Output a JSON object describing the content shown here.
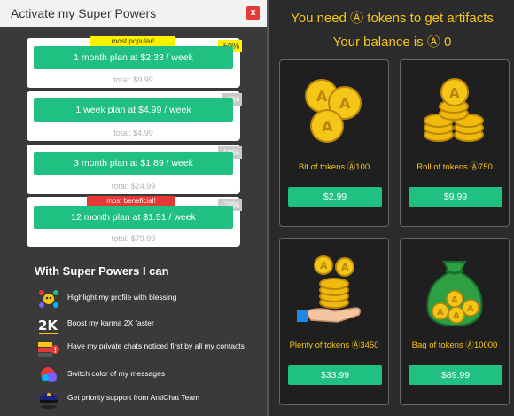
{
  "header": {
    "title": "Activate my Super Powers",
    "close": "x"
  },
  "plans": [
    {
      "button": "1 month plan at $2.33 / week",
      "total": "total: $9.99",
      "discount": "-50%",
      "ribbon": "most popular!"
    },
    {
      "button": "1 week plan at $4.99 / week",
      "total": "total: $4.99",
      "discount": "-0%",
      "ribbon": ""
    },
    {
      "button": "3 month plan at $1.89 / week",
      "total": "total: $24.99",
      "discount": "-60%",
      "ribbon": ""
    },
    {
      "button": "12 month plan at $1.51 / week",
      "total": "total: $79.99",
      "discount": "-70%",
      "ribbon": "most beneficial!"
    }
  ],
  "superpowers": {
    "title": "With Super Powers I can",
    "items": [
      {
        "icon": "blessing-icon",
        "text": "Highlight my profile with blessing"
      },
      {
        "icon": "karma-2x-icon",
        "text": "Boost my karma 2X faster"
      },
      {
        "icon": "chat-notice-icon",
        "text": "Have my private chats noticed first by all my contacts"
      },
      {
        "icon": "color-bubble-icon",
        "text": "Switch color of my messages"
      },
      {
        "icon": "support-icon",
        "text": "Get priority support from AntiChat Team"
      }
    ]
  },
  "shop": {
    "line1": "You need Ⓐ tokens to get artifacts",
    "line2": "Your balance is Ⓐ 0",
    "packs": [
      {
        "icon": "coins-pile-icon",
        "name": "Bit of tokens Ⓐ100",
        "price": "$2.99"
      },
      {
        "icon": "coins-roll-icon",
        "name": "Roll of tokens Ⓐ750",
        "price": "$9.99"
      },
      {
        "icon": "coins-hand-icon",
        "name": "Plenty of tokens Ⓐ3450",
        "price": "$33.99"
      },
      {
        "icon": "coins-bag-icon",
        "name": "Bag of tokens Ⓐ10000",
        "price": "$89.99"
      }
    ]
  },
  "colors": {
    "accent": "#1fc082",
    "gold": "#f5c518",
    "ribbon_yellow": "#fff200",
    "ribbon_red": "#e53935"
  }
}
